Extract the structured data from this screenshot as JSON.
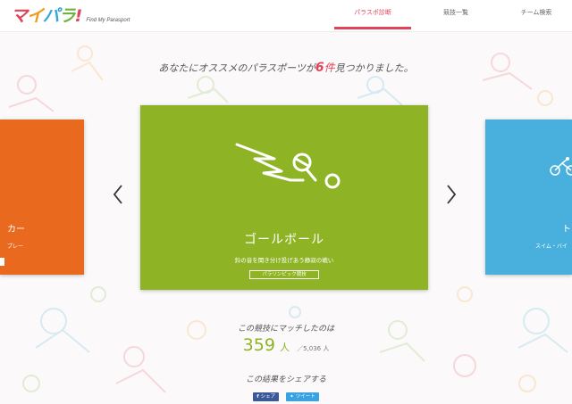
{
  "colors": {
    "accent": "#e2425a",
    "card_left": "#e96a1e",
    "card_main": "#8eb325",
    "card_right": "#49b0dd",
    "facebook": "#3b5998",
    "twitter": "#3aa2e0"
  },
  "header": {
    "logo_parts": [
      "マ",
      "イ",
      "パ",
      "ラ",
      "!"
    ],
    "logo_sub": "Find My Parasport",
    "nav": [
      {
        "label": "パラスポ診断",
        "active": true
      },
      {
        "label": "競技一覧",
        "active": false
      },
      {
        "label": "チーム検索",
        "active": false
      }
    ]
  },
  "result": {
    "prefix": "あなたにオススメのパラスポーツが",
    "count": "6",
    "count_unit": "件",
    "suffix": "見つかりました。"
  },
  "carousel": {
    "left_card": {
      "title_fragment": "カー",
      "sub_fragment": "プレー"
    },
    "main_card": {
      "title": "ゴールボール",
      "description": "鈴の音を聞き分け投げあう静寂の戦い",
      "tag": "パラリンピック競技",
      "icon": "goalball-player-icon"
    },
    "right_card": {
      "title_fragment": "ト",
      "sub_fragment": "スイム・バイ"
    },
    "prev_icon": "chevron-left-icon",
    "next_icon": "chevron-right-icon"
  },
  "match": {
    "label": "この競技にマッチしたのは",
    "count": "359",
    "unit": "人",
    "total": "／5,036 人"
  },
  "share": {
    "label": "この結果をシェアする",
    "facebook_label": "シェア",
    "twitter_label": "ツイート"
  }
}
